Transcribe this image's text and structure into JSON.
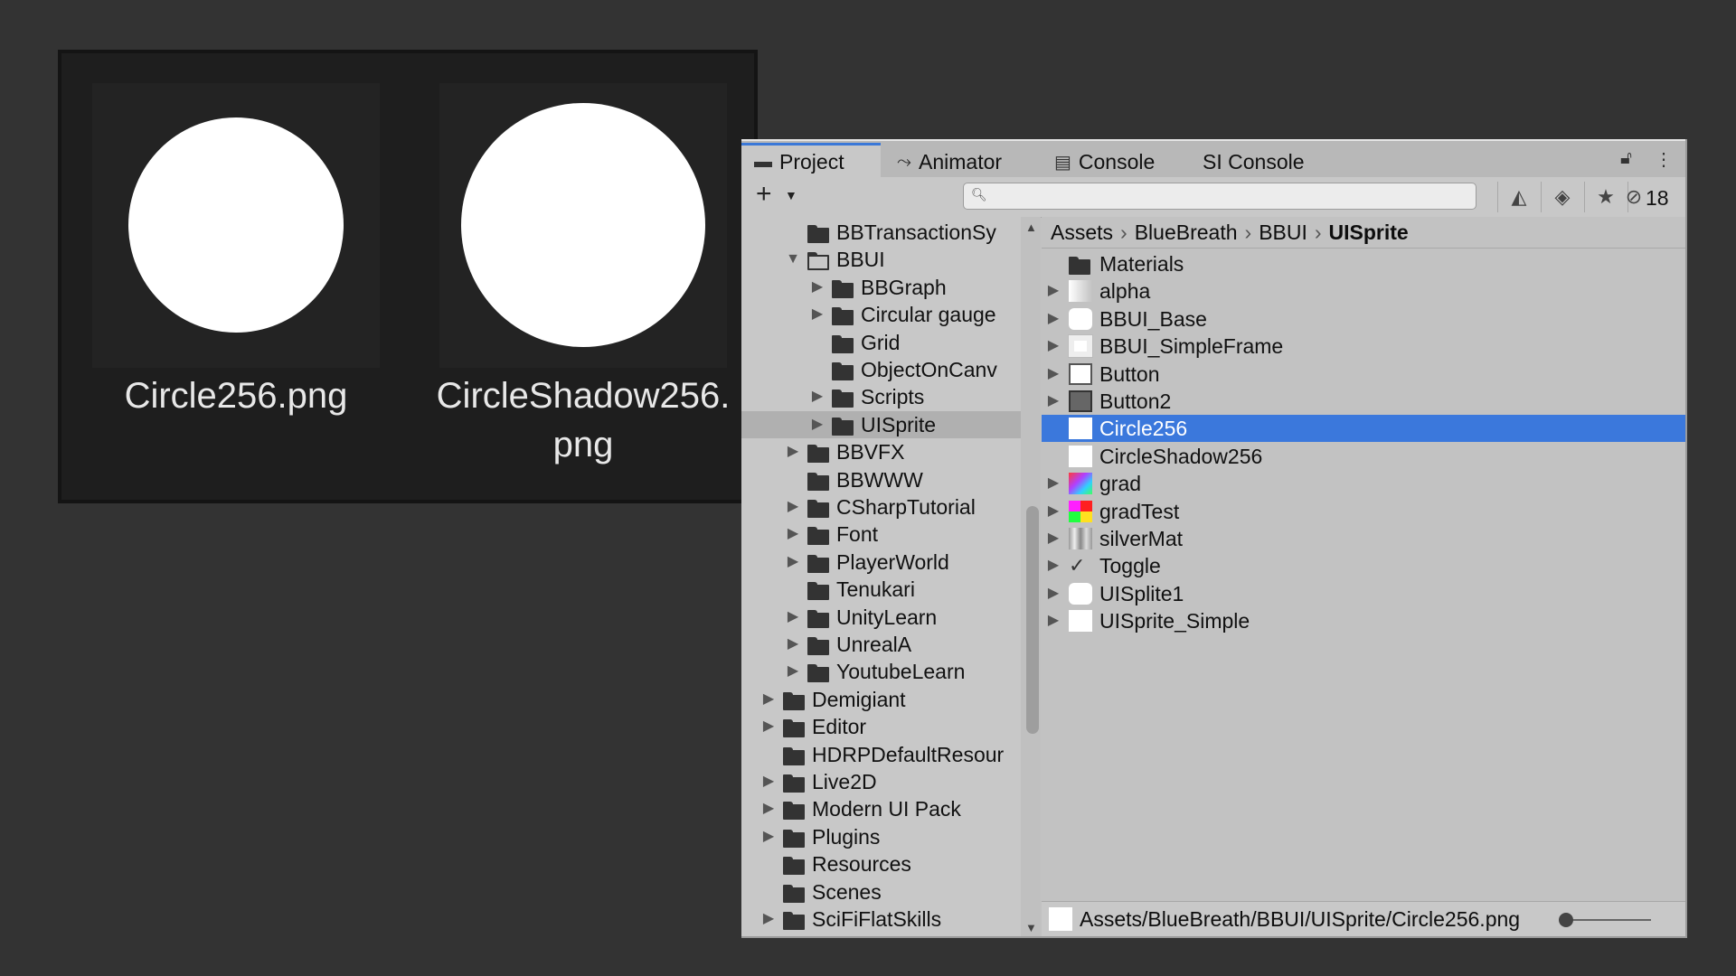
{
  "thumbnails": [
    {
      "label": "Circle256.png"
    },
    {
      "label": "CircleShadow256.png",
      "label_line1": "CircleShadow256.",
      "label_line2": "png"
    }
  ],
  "tabs": {
    "project": "Project",
    "animator": "Animator",
    "console": "Console",
    "si_console": "SI Console"
  },
  "toolbar": {
    "search_value": "",
    "hidden_count": "18"
  },
  "tree": [
    {
      "label": "BBTransactionSy",
      "indent": 2,
      "arrow": ""
    },
    {
      "label": "BBUI",
      "indent": 2,
      "arrow": "▼",
      "open": true
    },
    {
      "label": "BBGraph",
      "indent": 3,
      "arrow": "▶"
    },
    {
      "label": "Circular gauge",
      "indent": 3,
      "arrow": "▶"
    },
    {
      "label": "Grid",
      "indent": 3,
      "arrow": ""
    },
    {
      "label": "ObjectOnCanv",
      "indent": 3,
      "arrow": ""
    },
    {
      "label": "Scripts",
      "indent": 3,
      "arrow": "▶"
    },
    {
      "label": "UISprite",
      "indent": 3,
      "arrow": "▶",
      "selected": true
    },
    {
      "label": "BBVFX",
      "indent": 2,
      "arrow": "▶"
    },
    {
      "label": "BBWWW",
      "indent": 2,
      "arrow": ""
    },
    {
      "label": "CSharpTutorial",
      "indent": 2,
      "arrow": "▶"
    },
    {
      "label": "Font",
      "indent": 2,
      "arrow": "▶"
    },
    {
      "label": "PlayerWorld",
      "indent": 2,
      "arrow": "▶"
    },
    {
      "label": "Tenukari",
      "indent": 2,
      "arrow": ""
    },
    {
      "label": "UnityLearn",
      "indent": 2,
      "arrow": "▶"
    },
    {
      "label": "UnrealA",
      "indent": 2,
      "arrow": "▶"
    },
    {
      "label": "YoutubeLearn",
      "indent": 2,
      "arrow": "▶"
    },
    {
      "label": "Demigiant",
      "indent": 1,
      "arrow": "▶"
    },
    {
      "label": "Editor",
      "indent": 1,
      "arrow": "▶"
    },
    {
      "label": "HDRPDefaultResour",
      "indent": 1,
      "arrow": ""
    },
    {
      "label": "Live2D",
      "indent": 1,
      "arrow": "▶"
    },
    {
      "label": "Modern UI Pack",
      "indent": 1,
      "arrow": "▶"
    },
    {
      "label": "Plugins",
      "indent": 1,
      "arrow": "▶"
    },
    {
      "label": "Resources",
      "indent": 1,
      "arrow": ""
    },
    {
      "label": "Scenes",
      "indent": 1,
      "arrow": ""
    },
    {
      "label": "SciFiFlatSkills",
      "indent": 1,
      "arrow": "▶"
    }
  ],
  "breadcrumb": [
    "Assets",
    "BlueBreath",
    "BBUI",
    "UISprite"
  ],
  "assets": [
    {
      "label": "Materials",
      "arrow": "",
      "icon": "folder"
    },
    {
      "label": "alpha",
      "arrow": "▶",
      "icon": "alpha"
    },
    {
      "label": "BBUI_Base",
      "arrow": "▶",
      "icon": "white-rounded"
    },
    {
      "label": "BBUI_SimpleFrame",
      "arrow": "▶",
      "icon": "frame"
    },
    {
      "label": "Button",
      "arrow": "▶",
      "icon": "white-border"
    },
    {
      "label": "Button2",
      "arrow": "▶",
      "icon": "dark-square"
    },
    {
      "label": "Circle256",
      "arrow": "",
      "icon": "white",
      "selected": true
    },
    {
      "label": "CircleShadow256",
      "arrow": "",
      "icon": "white"
    },
    {
      "label": "grad",
      "arrow": "▶",
      "icon": "rainbow"
    },
    {
      "label": "gradTest",
      "arrow": "▶",
      "icon": "color-grid"
    },
    {
      "label": "silverMat",
      "arrow": "▶",
      "icon": "silver"
    },
    {
      "label": "Toggle",
      "arrow": "▶",
      "icon": "check"
    },
    {
      "label": "UISplite1",
      "arrow": "▶",
      "icon": "white-rounded"
    },
    {
      "label": "UISprite_Simple",
      "arrow": "▶",
      "icon": "white"
    }
  ],
  "status": {
    "path": "Assets/BlueBreath/BBUI/UISprite/Circle256.png",
    "zoom_fraction": 0.0
  },
  "colors": {
    "selection": "#3b78dc",
    "tab_accent": "#3a78d8"
  }
}
